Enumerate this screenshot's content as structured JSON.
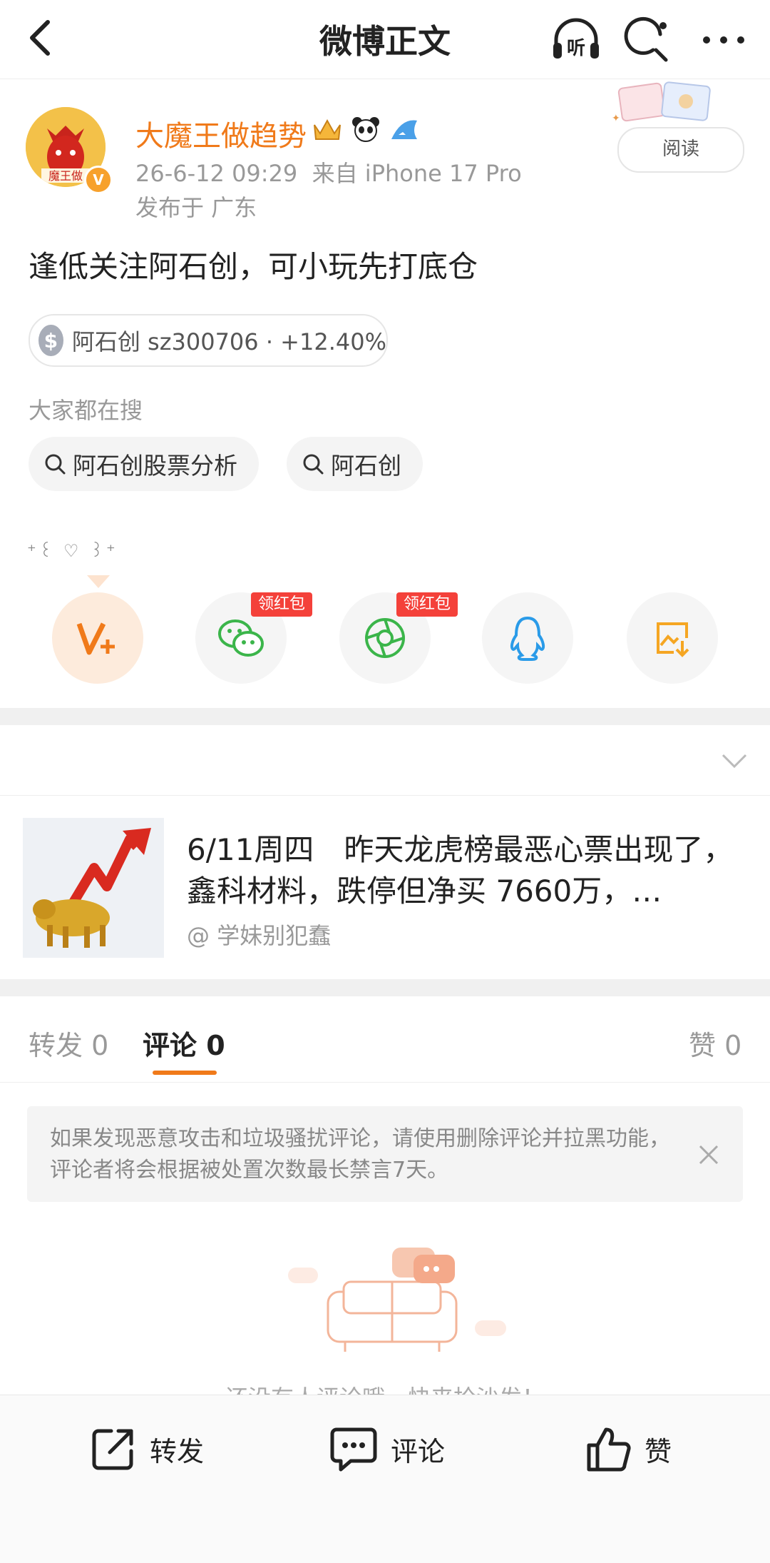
{
  "header": {
    "title": "微博正文",
    "listen_label": "听"
  },
  "author": {
    "name": "大魔王做趋势",
    "avatar_text": "魔王做",
    "verified_mark": "V",
    "time": "26-6-12 09:29",
    "source": "来自 iPhone 17 Pro",
    "location": "发布于 广东",
    "read_label": "阅读"
  },
  "post": {
    "text": "逢低关注阿石创，可小玩先打底仓",
    "stock_icon": "$",
    "stock": "阿石创 sz300706 · +12.40%"
  },
  "search": {
    "label": "大家都在搜",
    "chips": [
      "阿石创股票分析",
      "阿石创"
    ]
  },
  "emoji_row": "⁺꒰ ♡ ꒱⁺",
  "share": {
    "redpack_label": "领红包",
    "items": [
      "weibo-v-plus",
      "wechat",
      "moments",
      "qq",
      "save-image"
    ]
  },
  "card": {
    "title": "6/11周四　昨天龙虎榜最恶心票出现了，鑫科材料，跌停但净买 7660万，…",
    "author": "@ 学妹别犯蠢"
  },
  "tabs": {
    "repost": "转发 0",
    "comment": "评论 0",
    "like": "赞 0"
  },
  "notice": {
    "text": "如果发现恶意攻击和垃圾骚扰评论，请使用删除评论并拉黑功能，评论者将会根据被处置次数最长禁言7天。"
  },
  "empty": {
    "text": "还没有人评论哦，快来抢沙发！"
  },
  "bottom": {
    "repost": "转发",
    "comment": "评论",
    "like": "赞"
  },
  "colors": {
    "accent": "#f07a1a",
    "redpack": "#f4413a",
    "wechat": "#3bb54a",
    "qq": "#2a9be8"
  }
}
